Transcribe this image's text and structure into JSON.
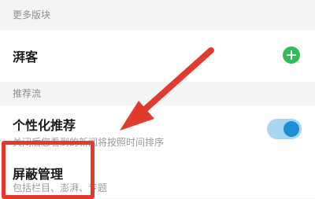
{
  "sections": {
    "more_modules": "更多版块",
    "recommend_flow": "推荐流"
  },
  "rows": {
    "paike": {
      "title": "湃客"
    },
    "personalized": {
      "title": "个性化推荐",
      "subtitle": "关闭后您看到的新闻将按照时间排序",
      "toggle_on": true
    },
    "block_manage": {
      "title": "屏蔽管理",
      "subtitle": "包括栏目、澎湃、专题"
    }
  },
  "colors": {
    "add_icon": "#2ebd59",
    "toggle_track": "#a9d6f1",
    "toggle_knob": "#1e8fd6",
    "annotation": "#e23b2e"
  },
  "icons": {
    "add": "add-circle-icon"
  }
}
